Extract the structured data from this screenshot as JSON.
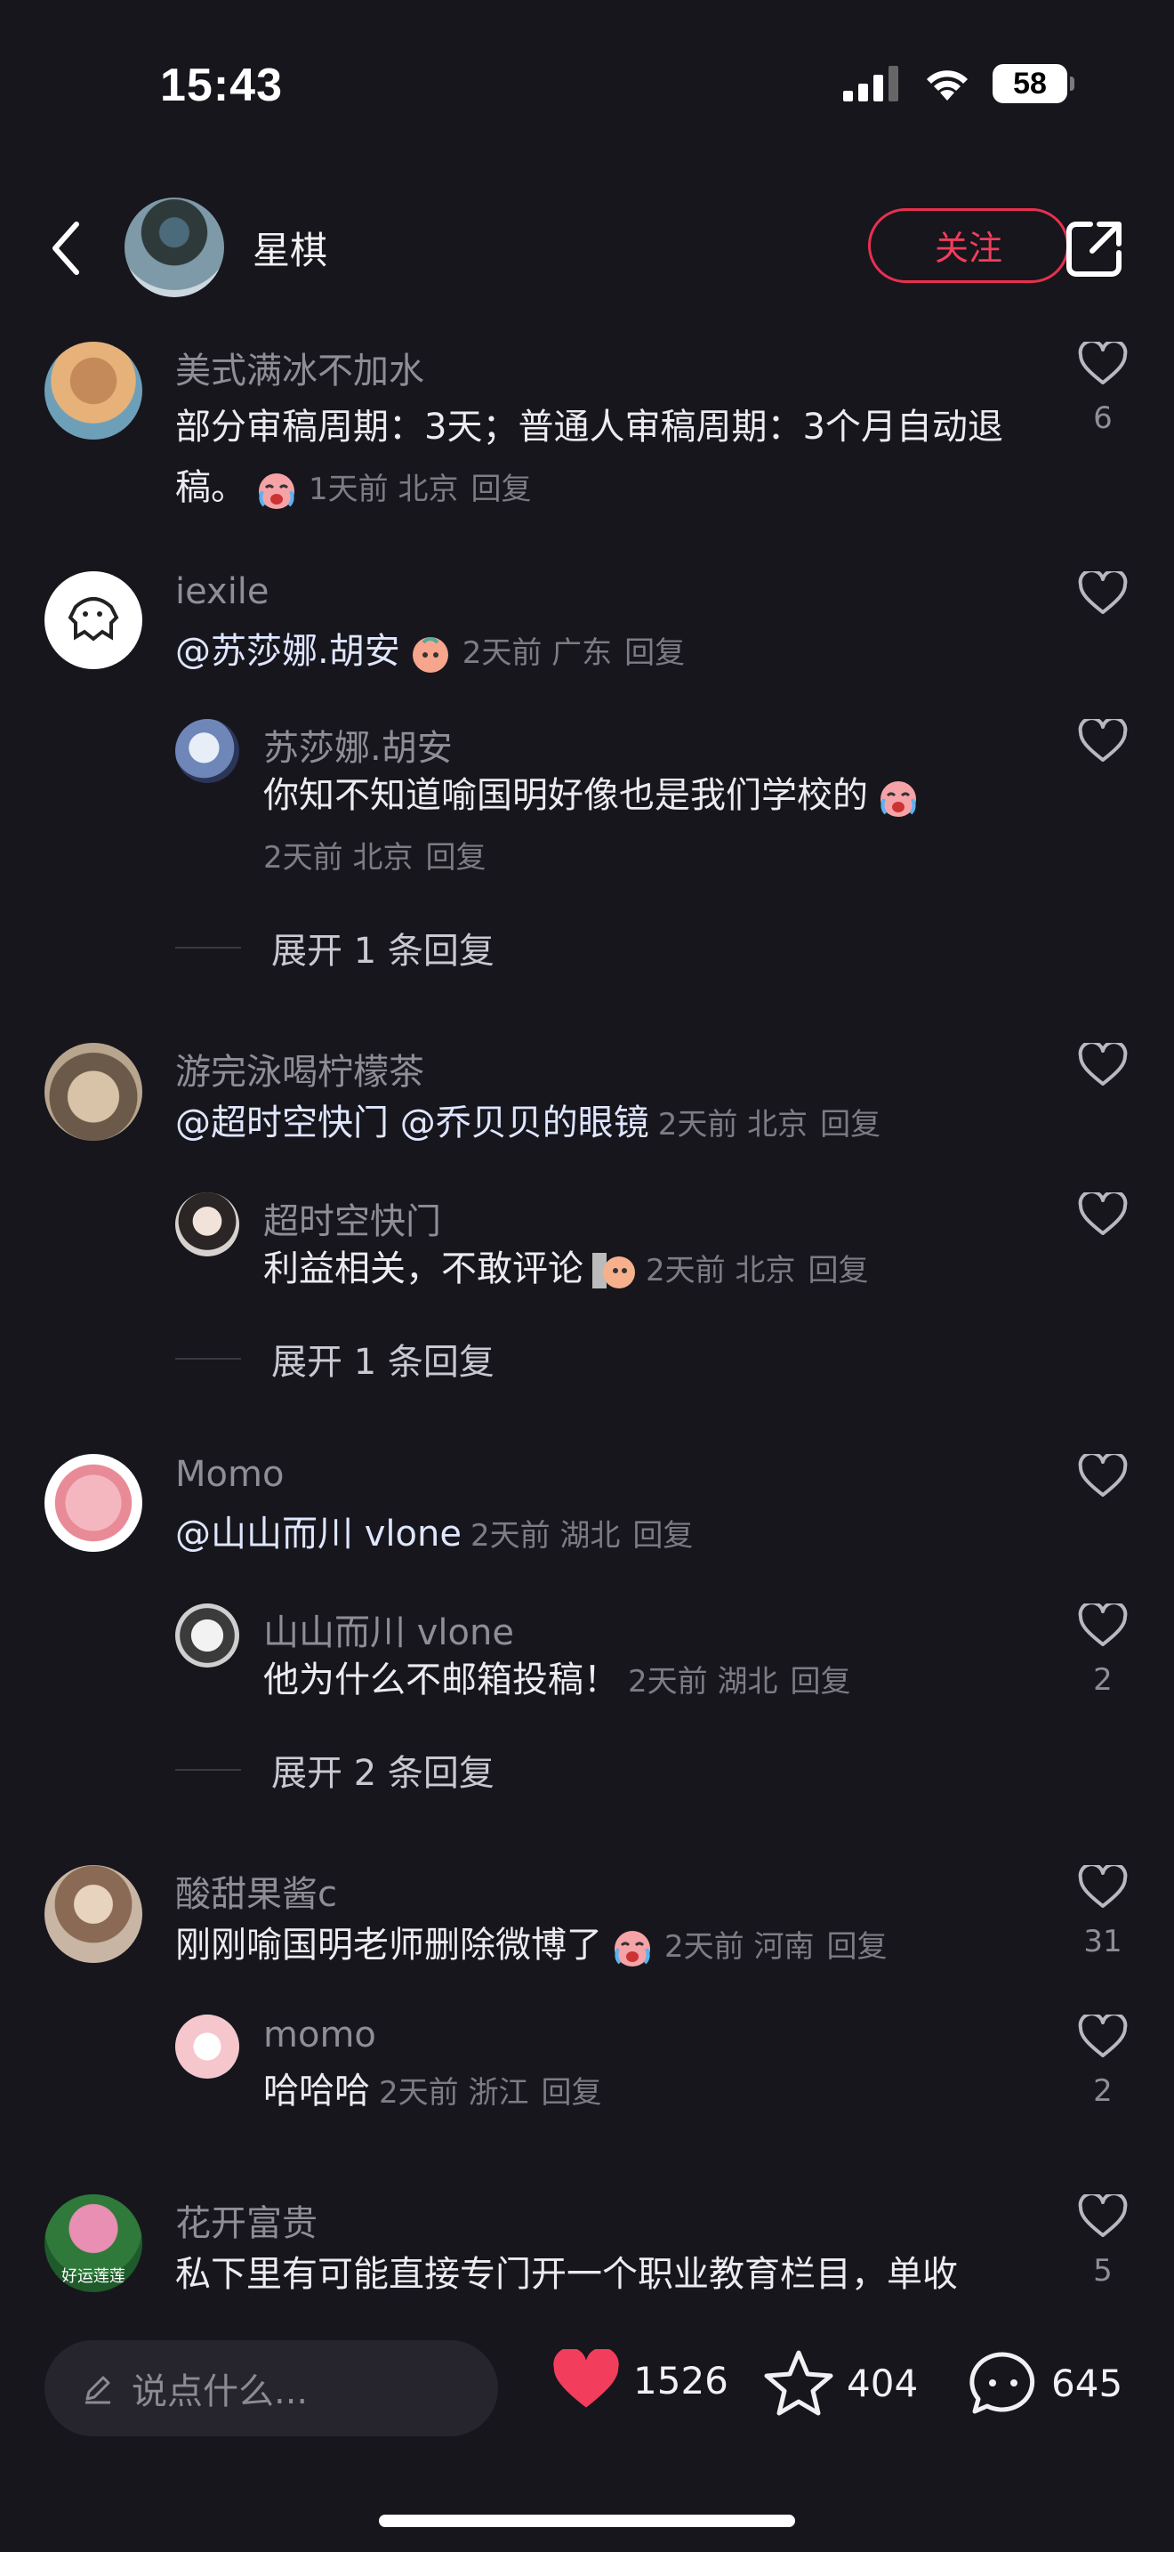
{
  "status_bar": {
    "time": "15:43",
    "battery": "58"
  },
  "header": {
    "author_name": "星棋",
    "follow_label": "关注"
  },
  "comments": [
    {
      "user": "美式满冰不加水",
      "text": "部分审稿周期：3天；普通人审稿周期：3个月自动退稿。",
      "time": "1天前",
      "location": "北京",
      "reply": "回复",
      "likes": "6"
    },
    {
      "user": "iexile",
      "mention": "@苏莎娜.胡安",
      "time": "2天前",
      "location": "广东",
      "reply": "回复",
      "likes": ""
    },
    {
      "user": "苏莎娜.胡安",
      "text": "你知不知道喻国明好像也是我们学校的",
      "time": "2天前",
      "location": "北京",
      "reply": "回复",
      "likes": ""
    },
    {
      "user": "游完泳喝柠檬茶",
      "mention": "@超时空快门 @乔贝贝的眼镜",
      "time": "2天前",
      "location": "北京",
      "reply": "回复",
      "likes": ""
    },
    {
      "user": "超时空快门",
      "text": "利益相关，不敢评论",
      "time": "2天前",
      "location": "北京",
      "reply": "回复",
      "likes": ""
    },
    {
      "user": "Momo",
      "mention": "@山山而川 vlone",
      "time": "2天前",
      "location": "湖北",
      "reply": "回复",
      "likes": ""
    },
    {
      "user": "山山而川 vlone",
      "text": "他为什么不邮箱投稿！",
      "time": "2天前",
      "location": "湖北",
      "reply": "回复",
      "likes": "2"
    },
    {
      "user": "酸甜果酱c",
      "text": "刚刚喻国明老师删除微博了",
      "time": "2天前",
      "location": "河南",
      "reply": "回复",
      "likes": "31"
    },
    {
      "user": "momo",
      "text": "哈哈哈",
      "time": "2天前",
      "location": "浙江",
      "reply": "回复",
      "likes": "2"
    },
    {
      "user": "花开富贵",
      "text": "私下里有可能直接专门开一个职业教育栏目，单收",
      "likes": "5",
      "avatar_text": "好运莲莲"
    }
  ],
  "expand": [
    "展开 1 条回复",
    "展开 1 条回复",
    "展开 2 条回复"
  ],
  "bottom": {
    "input_placeholder": "说点什么...",
    "likes": "1526",
    "favorites": "404",
    "comments": "645"
  },
  "colors": {
    "accent": "#f23d5c",
    "background": "#17161d"
  }
}
